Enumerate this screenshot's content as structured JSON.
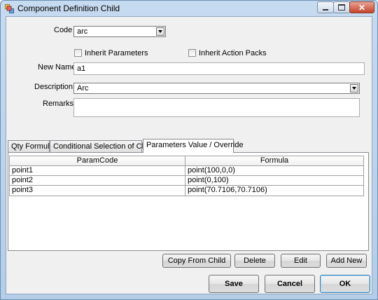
{
  "window": {
    "title": "Component Definition Child"
  },
  "fields": {
    "code_label": "Code",
    "code_value": "arc",
    "inherit_parameters_label": "Inherit Parameters",
    "inherit_action_packs_label": "Inherit Action Packs",
    "new_name_label": "New Name",
    "new_name_value": "a1",
    "description_label": "Description",
    "description_value": "Arc",
    "remarks_label": "Remarks",
    "remarks_value": ""
  },
  "tabs": [
    {
      "label": "Qty Formula"
    },
    {
      "label": "Conditional Selection of Child"
    },
    {
      "label": "Parameters Value / Override"
    }
  ],
  "grid": {
    "columns": [
      "ParamCode",
      "Formula"
    ],
    "rows": [
      [
        "point1",
        "point(100,0,0)"
      ],
      [
        "point2",
        "point(0,100)"
      ],
      [
        "point3",
        "point(70.7106,70.7106)"
      ]
    ]
  },
  "grid_buttons": {
    "copy_from_child": "Copy From Child",
    "delete": "Delete",
    "edit": "Edit",
    "add_new": "Add New"
  },
  "dialog_buttons": {
    "save": "Save",
    "cancel": "Cancel",
    "ok": "OK"
  },
  "icons": [
    "app-icon",
    "minimize-icon",
    "maximize-icon",
    "close-icon",
    "dropdown-arrow-icon"
  ]
}
